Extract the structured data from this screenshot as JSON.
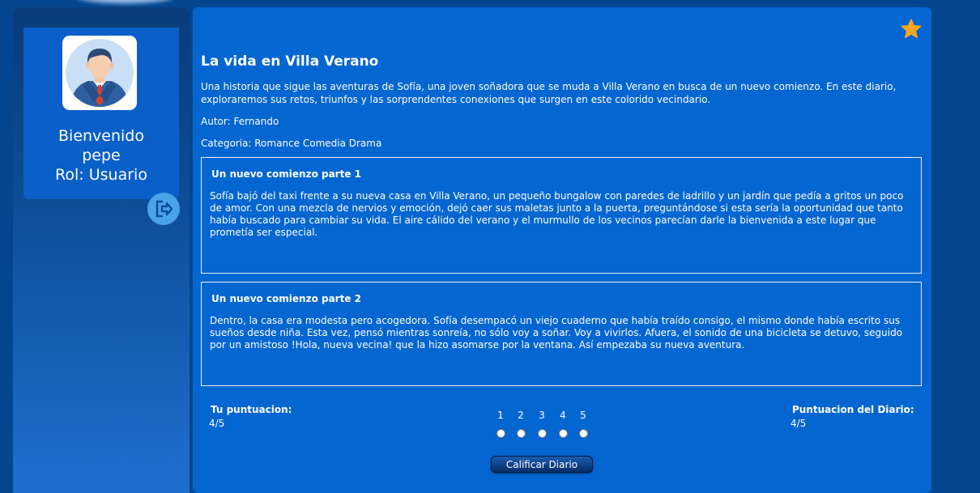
{
  "colors": {
    "page_bg": "#03468f",
    "main_bg": "#0466d0",
    "star": "#f5a623",
    "logout_button": "#4aa3e8"
  },
  "sidebar": {
    "avatar_icon": "businessman-avatar-icon",
    "greeting": "Bienvenido",
    "username": "pepe",
    "role": "Rol: Usuario",
    "logout_icon": "logout-arrow-icon"
  },
  "diary": {
    "favorite_icon": "star-icon",
    "title": "La vida en Villa Verano",
    "description": "Una historia que sigue las aventuras de Sofía, una joven soñadora que se muda a Villa Verano en busca de un nuevo comienzo. En este diario, exploraremos sus retos, triunfos y las sorprendentes conexiones que surgen en este colorido vecindario.",
    "author": "Autor: Fernando",
    "category": "Categoria: Romance Comedia Drama",
    "chapters": [
      {
        "title": "Un nuevo comienzo parte 1",
        "text": "Sofía bajó del taxi frente a su nueva casa en Villa Verano, un pequeño bungalow con paredes de ladrillo y un jardín que pedía a gritos un poco de amor. Con una mezcla de nervios y emoción, dejó caer sus maletas junto a la puerta, preguntándose si esta sería la oportunidad que tanto había buscado para cambiar su vida. El aire cálido del verano y el murmullo de los vecinos parecían darle la bienvenida a este lugar que prometía ser especial."
      },
      {
        "title": "Un nuevo comienzo parte 2",
        "text": "Dentro, la casa era modesta pero acogedora. Sofía desempacó un viejo cuaderno que había traído consigo, el mismo donde había escrito sus sueños desde niña. Esta vez, pensó mientras sonreía, no sólo voy a soñar. Voy a vivirlos. Afuera, el sonido de una bicicleta se detuvo, seguido por un amistoso !Hola, nueva vecina! que la hizo asomarse por la ventana. Así empezaba su nueva aventura."
      }
    ]
  },
  "rating": {
    "your_label": "Tu puntuacion:",
    "your_value": "4/5",
    "diary_label": "Puntuacion del Diario:",
    "diary_value": "4/5",
    "options": [
      "1",
      "2",
      "3",
      "4",
      "5"
    ],
    "submit_label": "Calificar Diario"
  }
}
